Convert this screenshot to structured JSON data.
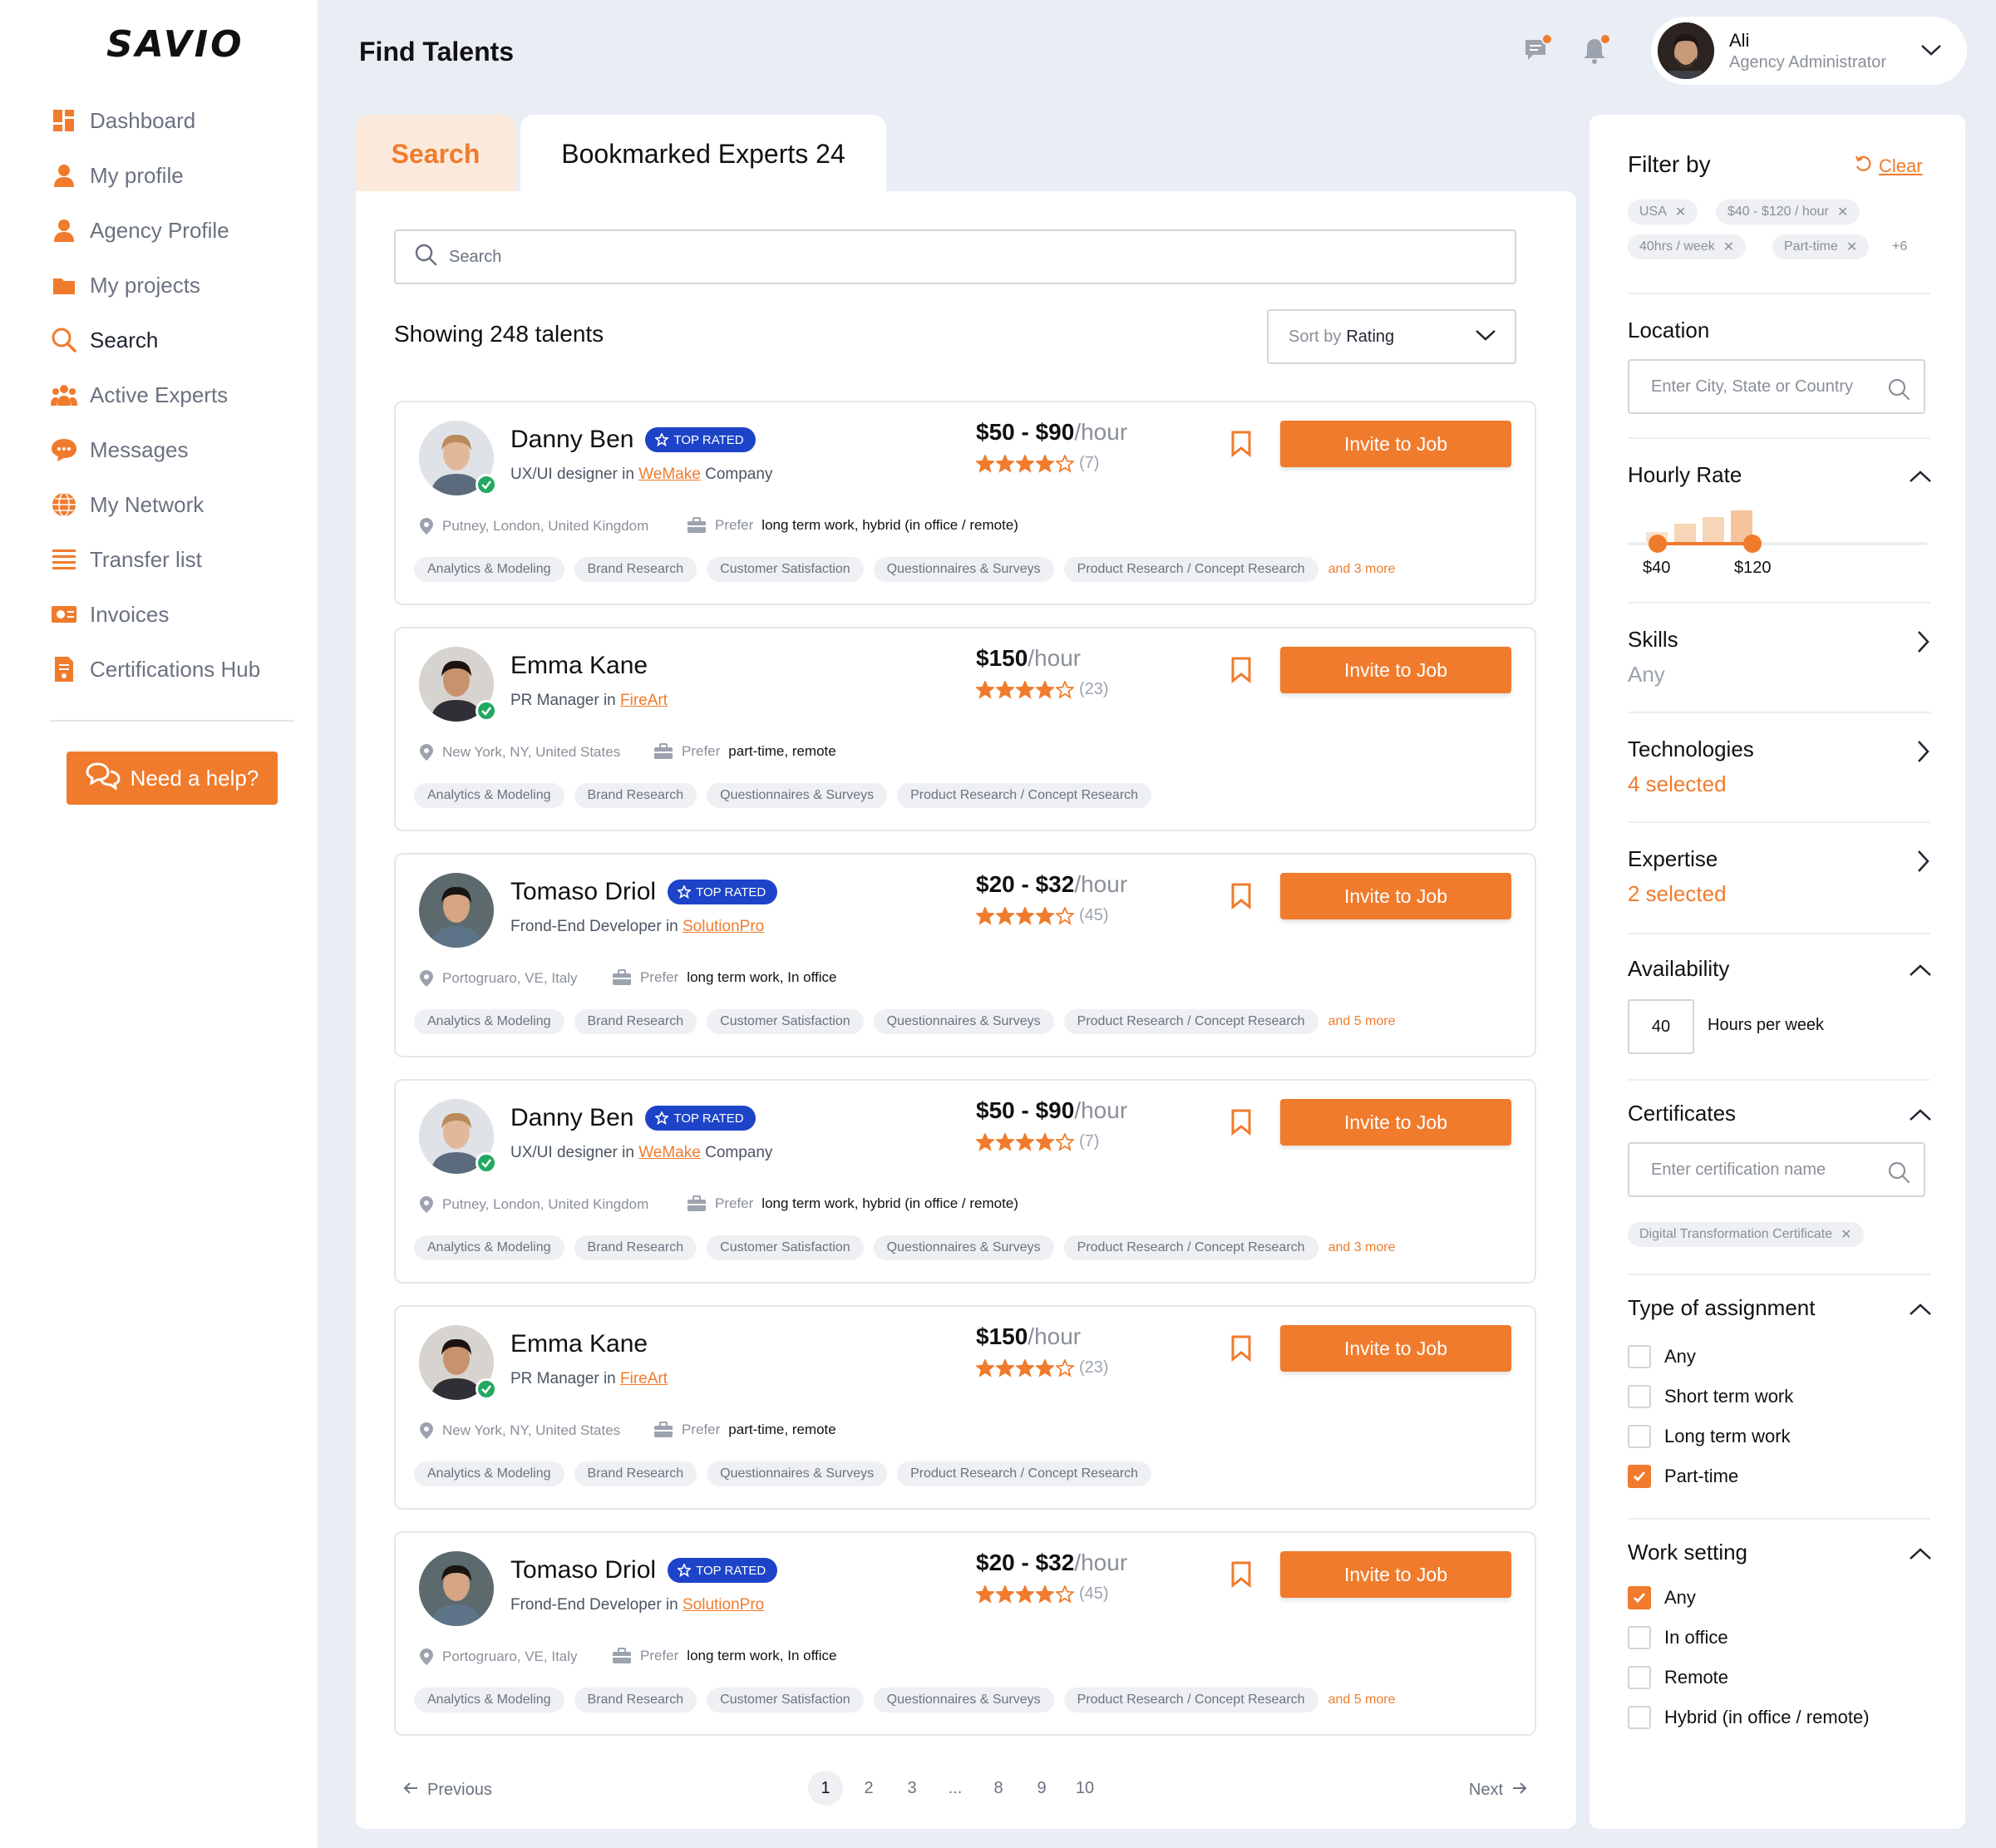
{
  "app": {
    "logo": "SAVIO",
    "page_title": "Find Talents"
  },
  "sidebar": {
    "items": [
      {
        "label": "Dashboard",
        "icon": "dashboard-icon"
      },
      {
        "label": "My profile",
        "icon": "user-icon"
      },
      {
        "label": "Agency Profile",
        "icon": "user-icon"
      },
      {
        "label": "My projects",
        "icon": "folder-icon"
      },
      {
        "label": "Search",
        "icon": "search-icon",
        "active": true
      },
      {
        "label": "Active Experts",
        "icon": "team-icon"
      },
      {
        "label": "Messages",
        "icon": "chat-icon"
      },
      {
        "label": "My Network",
        "icon": "globe-icon"
      },
      {
        "label": "Transfer list",
        "icon": "list-icon"
      },
      {
        "label": "Invoices",
        "icon": "invoice-icon"
      },
      {
        "label": "Certifications Hub",
        "icon": "certificate-icon"
      }
    ],
    "help_label": "Need a help?"
  },
  "header": {
    "user_name": "Ali",
    "user_role": "Agency Administrator"
  },
  "tabs": [
    {
      "label": "Search",
      "active": true
    },
    {
      "label": "Bookmarked Experts 24"
    }
  ],
  "main": {
    "search_placeholder": "Search",
    "showing": "Showing 248 talents",
    "sort_prefix": "Sort by",
    "sort_value": "Rating",
    "invite_label": "Invite to Job",
    "prefer_label": "Prefer",
    "top_rated_label": "TOP RATED"
  },
  "talents": [
    {
      "name": "Danny Ben",
      "top_rated": true,
      "role": "UX/UI designer in",
      "company": "WeMake",
      "company_suffix": "Company",
      "rate": "$50 - $90",
      "unit": "/hour",
      "rating": 4,
      "reviews": "(7)",
      "location": "Putney, London, United Kingdom",
      "prefer": "long term work, hybrid (in office / remote)",
      "tags": [
        "Analytics & Modeling",
        "Brand Research",
        "Customer Satisfaction",
        "Questionnaires & Surveys",
        "Product Research / Concept Research"
      ],
      "more": "and 3 more"
    },
    {
      "name": "Emma Kane",
      "top_rated": false,
      "role": "PR Manager in",
      "company": "FireArt",
      "company_suffix": "",
      "rate": "$150",
      "unit": "/hour",
      "rating": 4,
      "reviews": "(23)",
      "location": "New York, NY, United States",
      "prefer": "part-time, remote",
      "tags": [
        "Analytics & Modeling",
        "Brand Research",
        "Questionnaires & Surveys",
        "Product Research / Concept Research"
      ],
      "more": ""
    },
    {
      "name": "Tomaso Driol",
      "top_rated": true,
      "role": "Frond-End Developer in",
      "company": "SolutionPro",
      "company_suffix": "",
      "rate": "$20 - $32",
      "unit": "/hour",
      "rating": 4,
      "reviews": "(45)",
      "location": "Portogruaro, VE, Italy",
      "prefer": "long term work, In office",
      "tags": [
        "Analytics & Modeling",
        "Brand Research",
        "Customer Satisfaction",
        "Questionnaires & Surveys",
        "Product Research / Concept Research"
      ],
      "more": "and 5 more"
    },
    {
      "name": "Danny Ben",
      "top_rated": true,
      "role": "UX/UI designer in",
      "company": "WeMake",
      "company_suffix": "Company",
      "rate": "$50 - $90",
      "unit": "/hour",
      "rating": 4,
      "reviews": "(7)",
      "location": "Putney, London, United Kingdom",
      "prefer": "long term work, hybrid (in office / remote)",
      "tags": [
        "Analytics & Modeling",
        "Brand Research",
        "Customer Satisfaction",
        "Questionnaires & Surveys",
        "Product Research / Concept Research"
      ],
      "more": "and 3 more"
    },
    {
      "name": "Emma Kane",
      "top_rated": false,
      "role": "PR Manager in",
      "company": "FireArt",
      "company_suffix": "",
      "rate": "$150",
      "unit": "/hour",
      "rating": 4,
      "reviews": "(23)",
      "location": "New York, NY, United States",
      "prefer": "part-time, remote",
      "tags": [
        "Analytics & Modeling",
        "Brand Research",
        "Questionnaires & Surveys",
        "Product Research / Concept Research"
      ],
      "more": ""
    },
    {
      "name": "Tomaso Driol",
      "top_rated": true,
      "role": "Frond-End Developer in",
      "company": "SolutionPro",
      "company_suffix": "",
      "rate": "$20 - $32",
      "unit": "/hour",
      "rating": 4,
      "reviews": "(45)",
      "location": "Portogruaro, VE, Italy",
      "prefer": "long term work, In office",
      "tags": [
        "Analytics & Modeling",
        "Brand Research",
        "Customer Satisfaction",
        "Questionnaires & Surveys",
        "Product Research / Concept Research"
      ],
      "more": "and 5 more"
    }
  ],
  "pagination": {
    "previous": "Previous",
    "next": "Next",
    "pages": [
      "1",
      "2",
      "3",
      "...",
      "8",
      "9",
      "10"
    ],
    "current": "1"
  },
  "filter": {
    "title": "Filter by",
    "clear": "Clear",
    "chips": [
      "USA",
      "$40 - $120 / hour",
      "40hrs / week",
      "Part-time"
    ],
    "chips_more": "+6",
    "location": {
      "title": "Location",
      "placeholder": "Enter City, State or Country"
    },
    "hourly_rate": {
      "title": "Hourly Rate",
      "min": "$40",
      "max": "$120"
    },
    "skills": {
      "title": "Skills",
      "value": "Any"
    },
    "technologies": {
      "title": "Technologies",
      "value": "4 selected"
    },
    "expertise": {
      "title": "Expertise",
      "value": "2 selected"
    },
    "availability": {
      "title": "Availability",
      "hours": "40",
      "label": "Hours per week"
    },
    "certificates": {
      "title": "Certificates",
      "placeholder": "Enter certification name",
      "chip": "Digital Transformation Certificate"
    },
    "assignment": {
      "title": "Type of assignment",
      "options": [
        {
          "label": "Any",
          "checked": false
        },
        {
          "label": "Short term work",
          "checked": false
        },
        {
          "label": "Long term work",
          "checked": false
        },
        {
          "label": "Part-time",
          "checked": true
        }
      ]
    },
    "work_setting": {
      "title": "Work setting",
      "options": [
        {
          "label": "Any",
          "checked": true
        },
        {
          "label": "In office",
          "checked": false
        },
        {
          "label": "Remote",
          "checked": false
        },
        {
          "label": "Hybrid (in office / remote)",
          "checked": false
        }
      ]
    }
  },
  "colors": {
    "accent": "#f07b2c",
    "badge": "#1d44c8",
    "verified": "#22a861",
    "background": "#e9edf4"
  }
}
